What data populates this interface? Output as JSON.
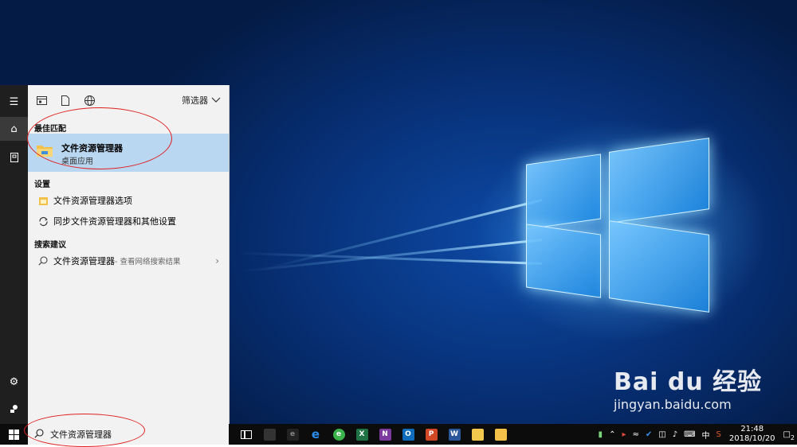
{
  "start_menu": {
    "toolbar": {
      "filter_label": "筛选器"
    },
    "best_match": {
      "section_title": "最佳匹配",
      "app_name": "文件资源管理器",
      "app_type": "桌面应用"
    },
    "settings": {
      "section_title": "设置",
      "items": [
        {
          "label": "文件资源管理器选项",
          "icon": "folder-options-icon"
        },
        {
          "label": "同步文件资源管理器和其他设置",
          "icon": "sync-icon"
        }
      ]
    },
    "search_suggestions": {
      "section_title": "搜索建议",
      "items": [
        {
          "label": "文件资源管理器",
          "suffix": " - 查看网络搜索结果"
        }
      ]
    }
  },
  "taskbar": {
    "search_query": "文件资源管理器",
    "time": "21:48",
    "date": "2018/10/20",
    "ime": "中",
    "notification_count": "2",
    "apps": [
      "task-view",
      "edge",
      "360",
      "excel",
      "onenote",
      "outlook",
      "powerpoint",
      "word",
      "photos",
      "file-explorer"
    ]
  },
  "watermark": {
    "brand": "Bai du 经验",
    "url": "jingyan.baidu.com"
  },
  "colors": {
    "accent_selected": "#b9d7f1",
    "desktop_blue": "#0d4aa6",
    "annotation": "#e02020"
  }
}
